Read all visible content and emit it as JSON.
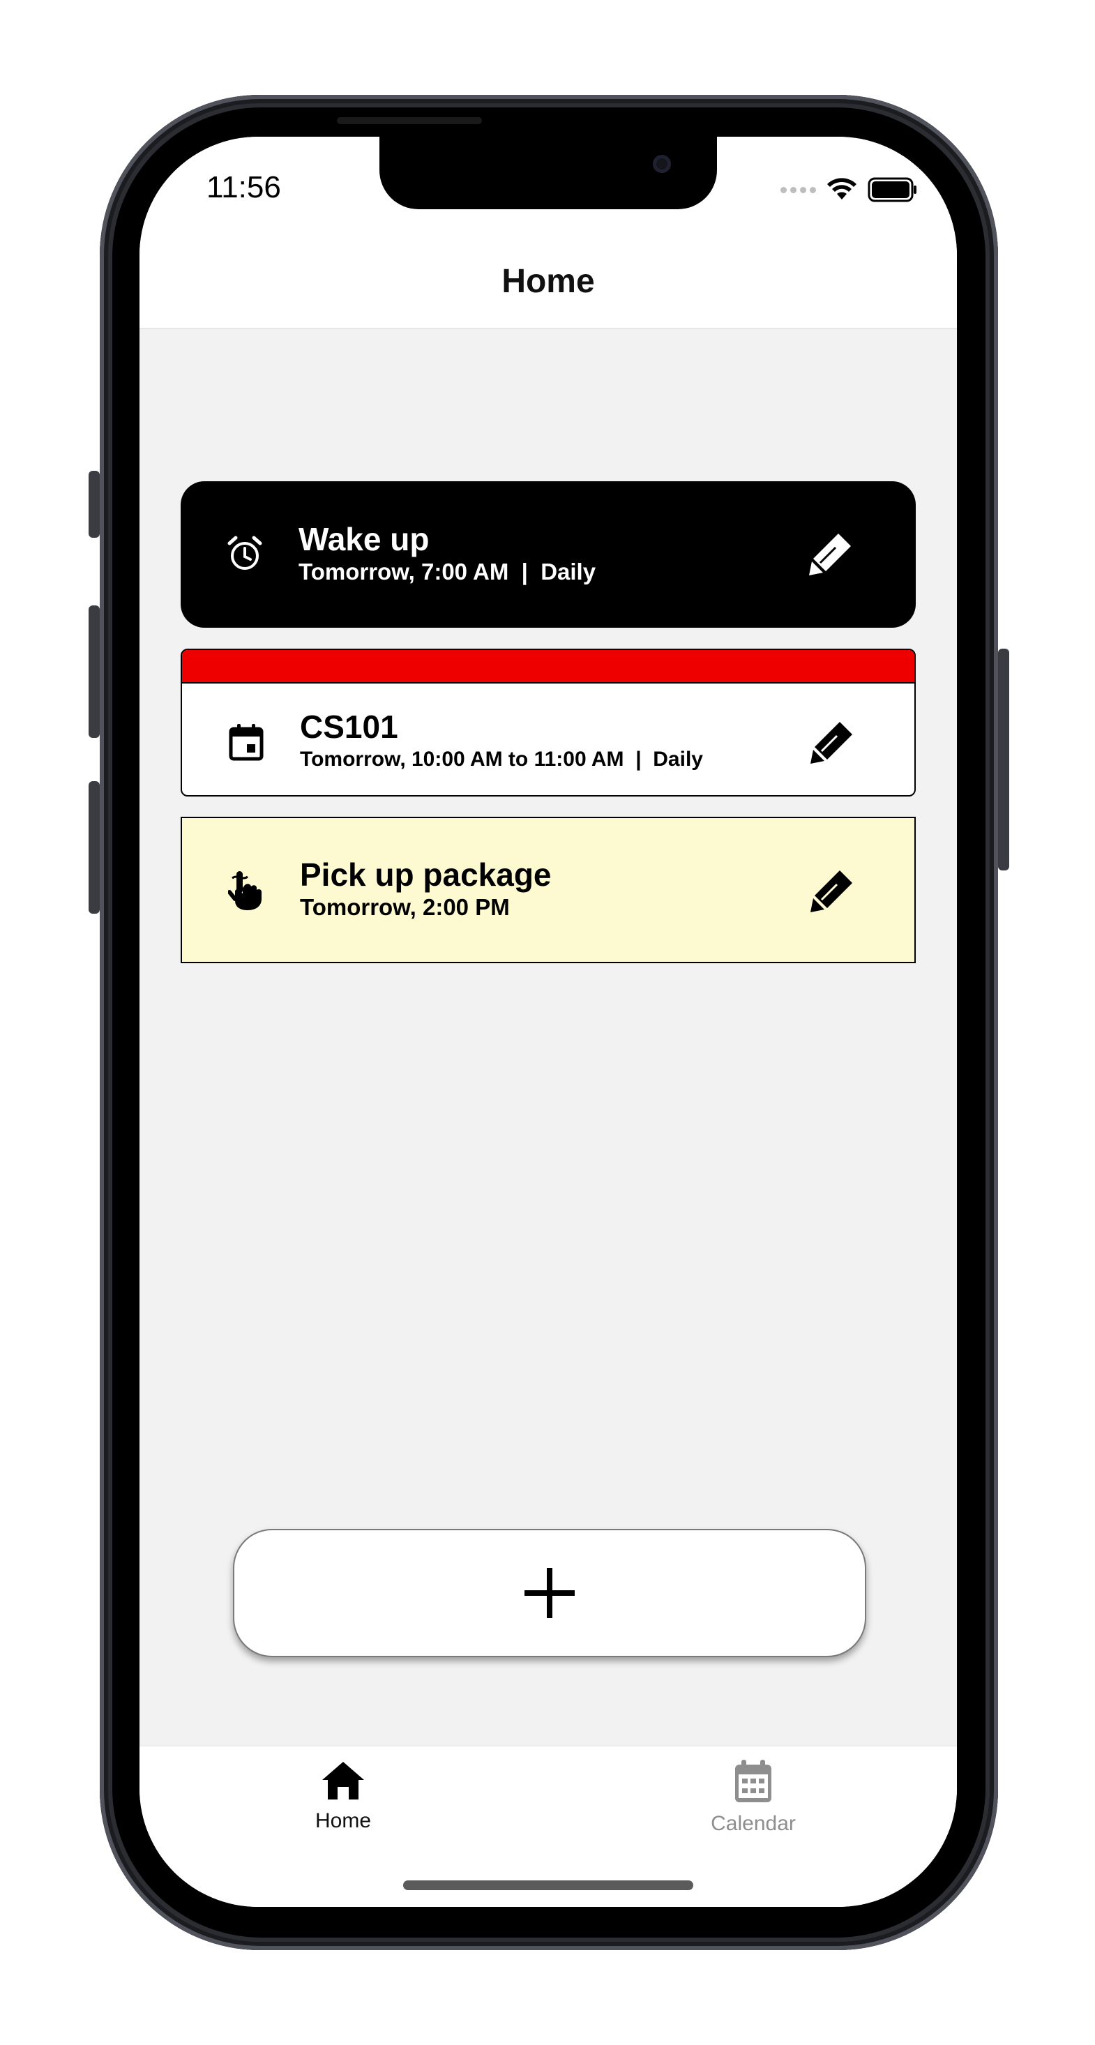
{
  "status_bar": {
    "time": "11:56"
  },
  "header": {
    "title": "Home"
  },
  "items": [
    {
      "kind": "alarm",
      "icon": "alarm-clock-icon",
      "title": "Wake up",
      "subtitle": "Tomorrow, 7:00 AM  |  Daily",
      "background": "#000000",
      "text_color": "#ffffff"
    },
    {
      "kind": "event",
      "icon": "calendar-icon",
      "title": "CS101",
      "subtitle": "Tomorrow, 10:00 AM to 11:00 AM  |  Daily",
      "accent_color": "#ee0000",
      "background": "#ffffff"
    },
    {
      "kind": "reminder",
      "icon": "finger-string-icon",
      "title": "Pick up package",
      "subtitle": "Tomorrow, 2:00 PM",
      "background": "#fdf9d0"
    }
  ],
  "add_button": {
    "icon": "plus-icon"
  },
  "tab_bar": {
    "tabs": [
      {
        "label": "Home",
        "icon": "home-icon",
        "active": true
      },
      {
        "label": "Calendar",
        "icon": "calendar-grid-icon",
        "active": false
      }
    ]
  }
}
